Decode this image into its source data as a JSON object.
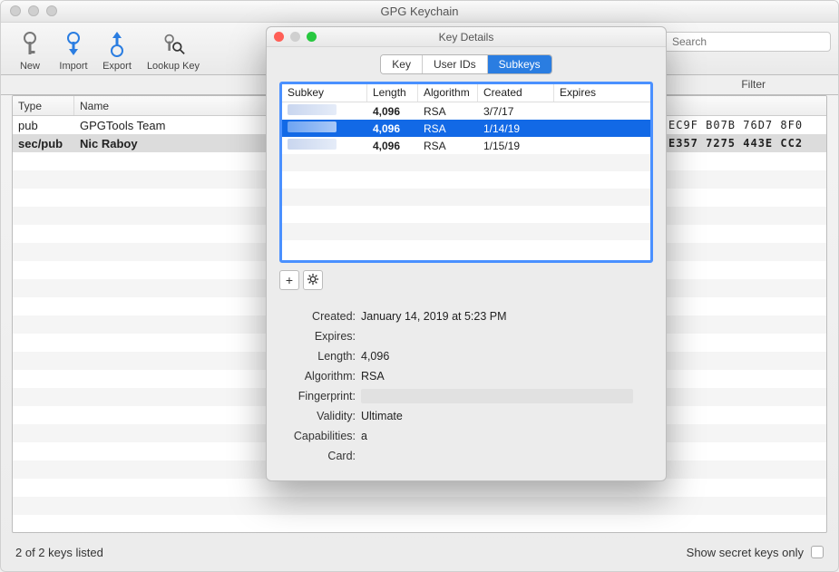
{
  "window": {
    "title": "GPG Keychain"
  },
  "toolbar": {
    "new": "New",
    "import": "Import",
    "export": "Export",
    "lookup": "Lookup Key",
    "search_placeholder": "Search",
    "filter_label": "Filter"
  },
  "keylist": {
    "columns": {
      "type": "Type",
      "name": "Name"
    },
    "rows": [
      {
        "type": "pub",
        "name": "GPGTools Team",
        "fp": "EC9F  B07B  76D7  8F0"
      },
      {
        "type": "sec/pub",
        "name": "Nic Raboy",
        "fp": "E357  7275  443E  CC2"
      }
    ]
  },
  "statusbar": {
    "count": "2 of 2 keys listed",
    "secret_only": "Show secret keys only"
  },
  "modal": {
    "title": "Key Details",
    "tabs": {
      "key": "Key",
      "userids": "User IDs",
      "subkeys": "Subkeys"
    },
    "subkey_cols": {
      "subkey": "Subkey",
      "length": "Length",
      "algorithm": "Algorithm",
      "created": "Created",
      "expires": "Expires"
    },
    "subkeys": [
      {
        "length": "4,096",
        "algorithm": "RSA",
        "created": "3/7/17",
        "expires": ""
      },
      {
        "length": "4,096",
        "algorithm": "RSA",
        "created": "1/14/19",
        "expires": ""
      },
      {
        "length": "4,096",
        "algorithm": "RSA",
        "created": "1/15/19",
        "expires": ""
      }
    ],
    "detail_labels": {
      "created": "Created:",
      "expires": "Expires:",
      "length": "Length:",
      "algorithm": "Algorithm:",
      "fingerprint": "Fingerprint:",
      "validity": "Validity:",
      "capabilities": "Capabilities:",
      "card": "Card:"
    },
    "detail_values": {
      "created": "January 14, 2019 at 5:23 PM",
      "expires": "",
      "length": "4,096",
      "algorithm": "RSA",
      "validity": "Ultimate",
      "capabilities": "a",
      "card": ""
    },
    "add_icon": "+",
    "gear_icon": "✱"
  }
}
